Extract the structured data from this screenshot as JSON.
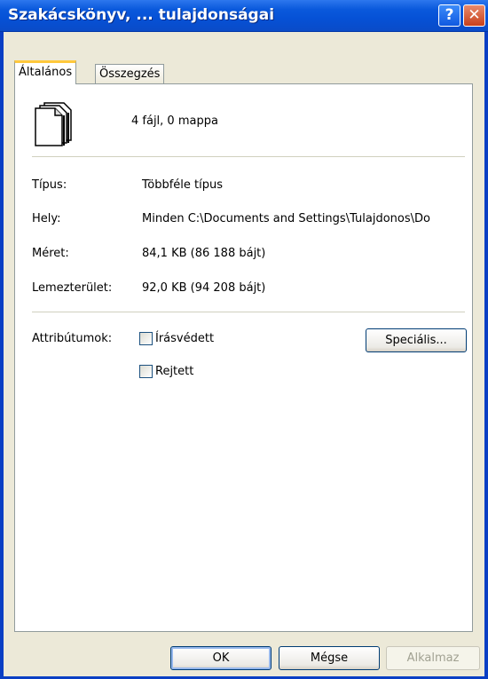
{
  "window": {
    "title": "Szakácskönyv, ... tulajdonságai",
    "help_label": "?",
    "close_label": "✕"
  },
  "tabs": [
    {
      "label": "Általános"
    },
    {
      "label": "Összegzés"
    }
  ],
  "summary": "4 fájl, 0 mappa",
  "props": {
    "type": {
      "label": "Típus:",
      "value": "Többféle típus"
    },
    "location": {
      "label": "Hely:",
      "value": "Minden C:\\Documents and Settings\\Tulajdonos\\Do"
    },
    "size": {
      "label": "Méret:",
      "value": "84,1 KB (86 188 bájt)"
    },
    "size_on_disk": {
      "label": "Lemezterület:",
      "value": "92,0 KB (94 208 bájt)"
    }
  },
  "attributes": {
    "label": "Attribútumok:",
    "readonly": {
      "label": "Írásvédett",
      "checked": false
    },
    "hidden": {
      "label": "Rejtett",
      "checked": false
    },
    "advanced_label": "Speciális..."
  },
  "buttons": {
    "ok": "OK",
    "cancel": "Mégse",
    "apply": "Alkalmaz"
  },
  "icons": {
    "files": "multiple-files-icon",
    "help": "help-icon",
    "close": "close-icon"
  },
  "colors": {
    "titlebar": "#0a59dc",
    "face": "#ece9d8",
    "active_tab": "#ffc83c"
  }
}
